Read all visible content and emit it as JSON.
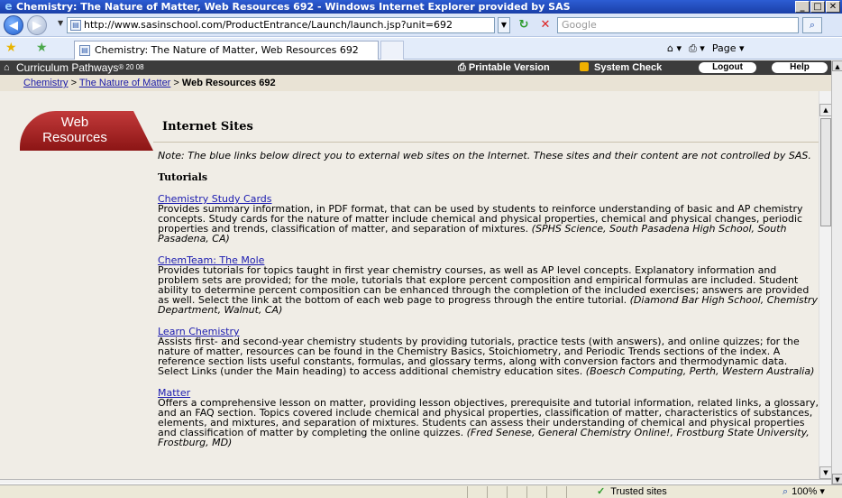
{
  "window": {
    "title": "Chemistry: The Nature of Matter, Web Resources 692 - Windows Internet Explorer provided by SAS",
    "minimize": "_",
    "maximize": "□",
    "close": "✕"
  },
  "address_bar": {
    "url": "http://www.sasinschool.com/ProductEntrance/Launch/launch.jsp?unit=692",
    "search_placeholder": "Google"
  },
  "tabs": {
    "active_tab": "Chemistry: The Nature of Matter, Web Resources 692"
  },
  "ie_tools": {
    "home": "⌂ ▾",
    "print": "⎙ ▾",
    "page": "Page ▾"
  },
  "app_header": {
    "brand": "Curriculum Pathways",
    "brand_suffix": "® 20 08",
    "printable": "Printable Version",
    "system_check": "System Check",
    "logout": "Logout",
    "help": "Help"
  },
  "breadcrumb": {
    "item1": "Chemistry",
    "sep": " > ",
    "item2": "The Nature of Matter",
    "current": "Web Resources 692"
  },
  "sidebar": {
    "label_line1": "Web",
    "label_line2": "Resources"
  },
  "main": {
    "heading": "Internet Sites",
    "note": "Note: The blue links below direct you to external web sites on the Internet. These sites and their content are not controlled by SAS.",
    "section_title": "Tutorials",
    "sites": [
      {
        "link": "Chemistry Study Cards",
        "description": "Provides summary information, in PDF format, that can be used by students to reinforce understanding of basic and AP chemistry concepts. Study cards for the nature of matter include chemical and physical properties, chemical and physical changes, periodic properties and trends, classification of matter, and separation of mixtures.",
        "source": "(SPHS Science, South Pasadena High School, South Pasadena, CA)"
      },
      {
        "link": "ChemTeam: The Mole",
        "description": "Provides tutorials for topics taught in first year chemistry courses, as well as AP level concepts. Explanatory information and problem sets are provided; for the mole, tutorials that explore percent composition and empirical formulas are included. Student ability to determine percent composition can be enhanced through the completion of the included exercises; answers are provided as well. Select the link at the bottom of each web page to progress through the entire tutorial.",
        "source": "(Diamond Bar High School, Chemistry Department, Walnut, CA)"
      },
      {
        "link": "Learn Chemistry",
        "description": "Assists first- and second-year chemistry students by providing tutorials, practice tests (with answers), and online quizzes; for the nature of matter, resources can be found in the Chemistry Basics, Stoichiometry, and Periodic Trends sections of the index. A reference section lists useful constants, formulas, and glossary terms, along with conversion factors and thermodynamic data. Select Links (under the Main heading) to access additional chemistry education sites.",
        "source": "(Boesch Computing, Perth, Western Australia)"
      },
      {
        "link": "Matter",
        "description": "Offers a comprehensive lesson on matter, providing lesson objectives, prerequisite and tutorial information, related links, a glossary, and an FAQ section. Topics covered include chemical and physical properties, classification of matter, characteristics of substances, elements, and mixtures, and separation of mixtures. Students can assess their understanding of chemical and physical properties and classification of matter by completing the online quizzes.",
        "source": "(Fred Senese, General Chemistry Online!, Frostburg State University, Frostburg, MD)"
      }
    ]
  },
  "status_bar": {
    "zone": "Trusted sites",
    "zoom": "100%"
  }
}
